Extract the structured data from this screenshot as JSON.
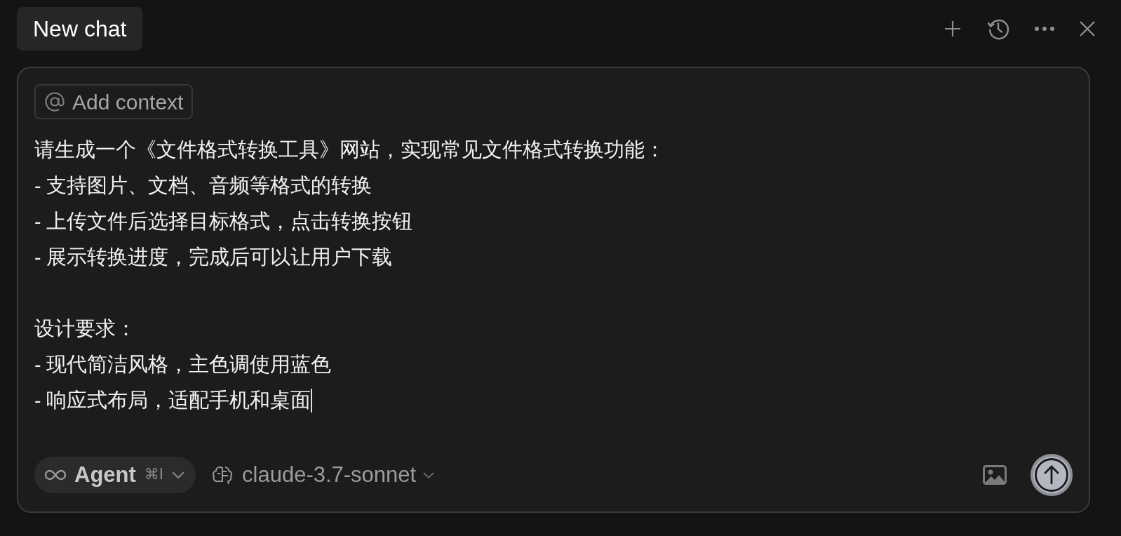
{
  "tabs": [
    {
      "label": "New chat",
      "selected": true
    }
  ],
  "composer": {
    "context_chip": "Add context",
    "paragraphs": [
      [
        "请生成一个《文件格式转换工具》网站，实现常见文件格式转换功能：",
        "- 支持图片、文档、音频等格式的转换",
        "- 上传文件后选择目标格式，点击转换按钮",
        "- 展示转换进度，完成后可以让用户下载"
      ],
      [
        "设计要求：",
        "- 现代简洁风格，主色调使用蓝色",
        "- 响应式布局，适配手机和桌面"
      ]
    ],
    "mode": {
      "label": "Agent",
      "shortcut": "⌘I"
    },
    "model": "claude-3.7-sonnet"
  }
}
